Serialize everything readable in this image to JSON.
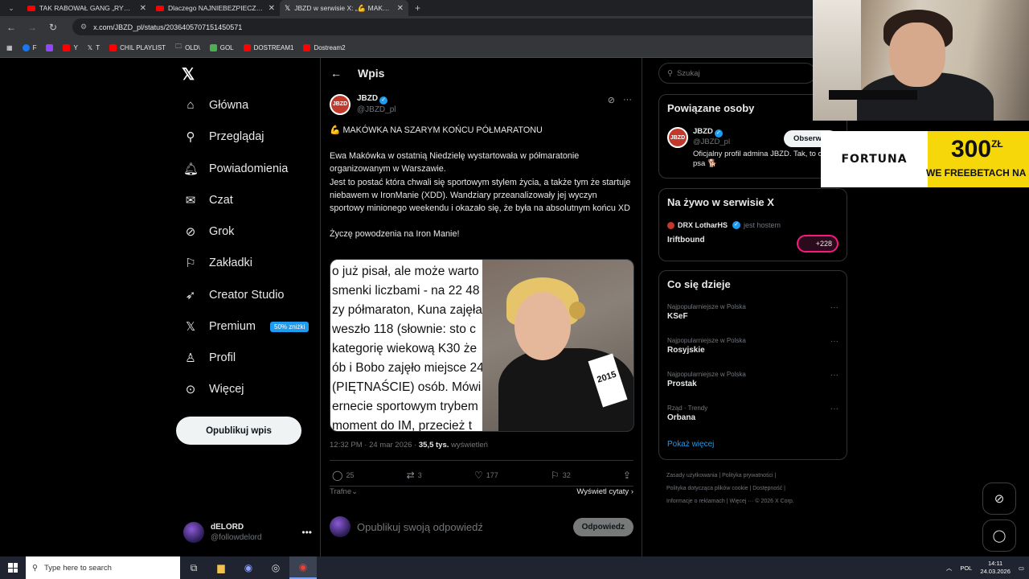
{
  "browser": {
    "tabs": [
      {
        "title": "TAK RABOWAŁ GANG „RYMPAŁ",
        "favicon": "youtube-icon",
        "active": false
      },
      {
        "title": "Dlaczego NAJNIEBEZPIECZNIEJ",
        "favicon": "youtube-icon",
        "active": false
      },
      {
        "title": "JBZD w serwisie X: „💪 MAKÓW",
        "favicon": "x-icon",
        "active": true
      }
    ],
    "url": "x.com/JBZD_pl/status/2036405707151450571",
    "bookmarks": [
      {
        "label": "F",
        "icon": "facebook-icon"
      },
      {
        "label": "",
        "icon": "twitch-icon"
      },
      {
        "label": "Y",
        "icon": "youtube-icon"
      },
      {
        "label": "T",
        "icon": "x-icon"
      },
      {
        "label": "CHIL PLAYLIST",
        "icon": "youtube-icon"
      },
      {
        "label": "OLD\\",
        "icon": "folder-icon"
      },
      {
        "label": "GOL",
        "icon": "gol-icon"
      },
      {
        "label": "DOSTREAM1",
        "icon": "youtube-icon"
      },
      {
        "label": "Dostream2",
        "icon": "youtube-icon"
      }
    ]
  },
  "nav": {
    "items": [
      {
        "label": "Główna",
        "icon": "home-icon"
      },
      {
        "label": "Przeglądaj",
        "icon": "search-icon"
      },
      {
        "label": "Powiadomienia",
        "icon": "bell-icon"
      },
      {
        "label": "Czat",
        "icon": "mail-icon"
      },
      {
        "label": "Grok",
        "icon": "grok-icon"
      },
      {
        "label": "Zakładki",
        "icon": "bookmark-icon"
      },
      {
        "label": "Creator Studio",
        "icon": "rocket-icon"
      },
      {
        "label": "Premium",
        "icon": "x-icon"
      },
      {
        "label": "Profil",
        "icon": "person-icon"
      },
      {
        "label": "Więcej",
        "icon": "more-circle-icon"
      }
    ],
    "premium_badge": "50% zniżki",
    "post_button": "Opublikuj wpis",
    "me": {
      "name": "dELORD",
      "handle": "@followdelord"
    }
  },
  "main": {
    "header_title": "Wpis",
    "author": {
      "name": "JBZD",
      "handle": "@JBZD_pl"
    },
    "headline": "💪 MAKÓWKA NA SZARYM KOŃCU PÓŁMARATONU",
    "paragraph_1": "Ewa Makówka w ostatnią Niedzielę wystartowała w półmaratonie organizowanym w Warszawie.",
    "paragraph_2": "Jest to postać która chwali się sportowym stylem życia, a także tym że startuje niebawem w IronManie (XDD). Wandziary przeanalizowały jej wyczyn sportowy minionego weekendu i okazało się, że była na absolutnym końcu XD",
    "paragraph_3": "Życzę powodzenia na Iron Manie!",
    "image_text_lines": [
      "o już pisał, ale może warto",
      "smenki liczbami - na 22 48",
      "zy półmaraton, Kuna zajęła",
      "weszło 118 (słownie: sto c",
      "kategorię wiekową K30 że",
      "ób i Bobo zajęło miejsce 24",
      "(PIĘTNAŚCIE) osób. Mówi",
      "ernecie sportowym trybem",
      "moment do IM, przecież t"
    ],
    "bib_number": "2015",
    "timestamp": "12:32 PM · 24 mar 2026 · ",
    "views_count": "35,5 tys.",
    "views_label": " wyświetleń",
    "actions": {
      "replies": "25",
      "reposts": "3",
      "likes": "177",
      "bookmarks": "32"
    },
    "sort_label": "Trafne",
    "quotes_link": "Wyświetl cytaty",
    "reply_placeholder": "Opublikuj swoją odpowiedź",
    "reply_button": "Odpowiedz"
  },
  "sidebar": {
    "search_placeholder": "Szukaj",
    "related": {
      "title": "Powiązane osoby",
      "name": "JBZD",
      "handle": "@JBZD_pl",
      "bio": "Oficjalny profil admina JBZD. Tak, to od psa 🐕",
      "follow_button": "Obserwuj"
    },
    "live": {
      "title": "Na żywo w serwisie X",
      "host": "DRX LotharHS",
      "host_label": "jest hostem",
      "show": "Iriftbound",
      "listeners": "+228"
    },
    "trends": {
      "title": "Co się dzieje",
      "items": [
        {
          "context": "Najpopularniejsze w Polska",
          "name": "KSeF"
        },
        {
          "context": "Najpopularniejsze w Polska",
          "name": "Rosyjskie"
        },
        {
          "context": "Najpopularniejsze w Polska",
          "name": "Prostak"
        },
        {
          "context": "Rząd · Trendy",
          "name": "Orbana"
        }
      ],
      "show_more": "Pokaż więcej"
    },
    "footer": {
      "line1": "Zasady użytkowania  |  Polityka prywatności  |",
      "line2": "Polityka dotycząca plików cookie  |  Dostępność  |",
      "line3": "Informacje o reklamach  |  Więcej ···  © 2026 X Corp."
    }
  },
  "ad": {
    "brand": "FORTUNA",
    "amount": "300",
    "currency": "ZŁ",
    "subtitle": "WE FREEBETACH NA STA"
  },
  "taskbar": {
    "search_placeholder": "Type here to search",
    "language": "POL",
    "time": "14:11",
    "date": "24.03.2026"
  }
}
